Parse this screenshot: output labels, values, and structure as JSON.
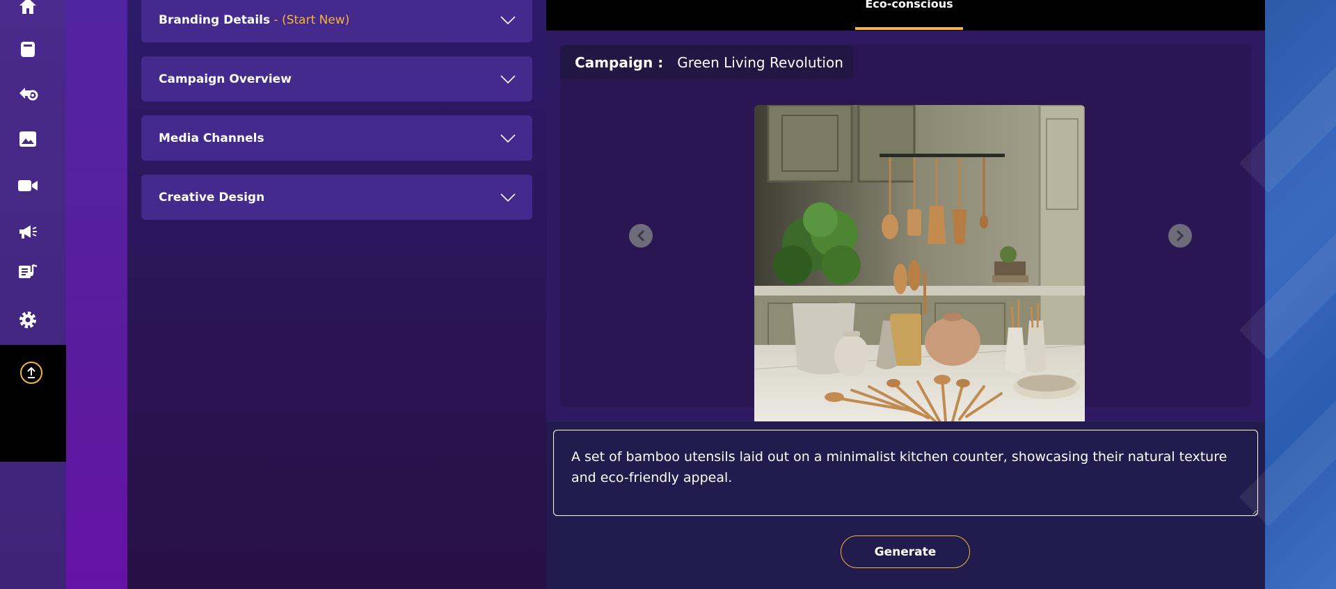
{
  "sidebar": {
    "icons": [
      "home-icon",
      "save-icon",
      "brain-gear-icon",
      "image-icon",
      "video-icon",
      "megaphone-icon",
      "music-text-icon",
      "gear-icon"
    ],
    "upload_icon": "upload-icon"
  },
  "accordion": {
    "items": [
      {
        "title": "Branding Details",
        "subtitle": " - (Start New)"
      },
      {
        "title": "Campaign Overview",
        "subtitle": ""
      },
      {
        "title": "Media Channels",
        "subtitle": ""
      },
      {
        "title": "Creative Design",
        "subtitle": ""
      }
    ]
  },
  "tabs": {
    "active_label": "Eco-conscious"
  },
  "campaign": {
    "label": "Campaign :",
    "name": "Green Living Revolution"
  },
  "prompt": {
    "text": "A set of bamboo utensils laid out on a minimalist kitchen counter, showcasing their natural texture and eco-friendly appeal."
  },
  "actions": {
    "generate_label": "Generate"
  },
  "colors": {
    "accent": "#f5b63a",
    "panel": "#432a8c",
    "background": "#2d1a63"
  }
}
